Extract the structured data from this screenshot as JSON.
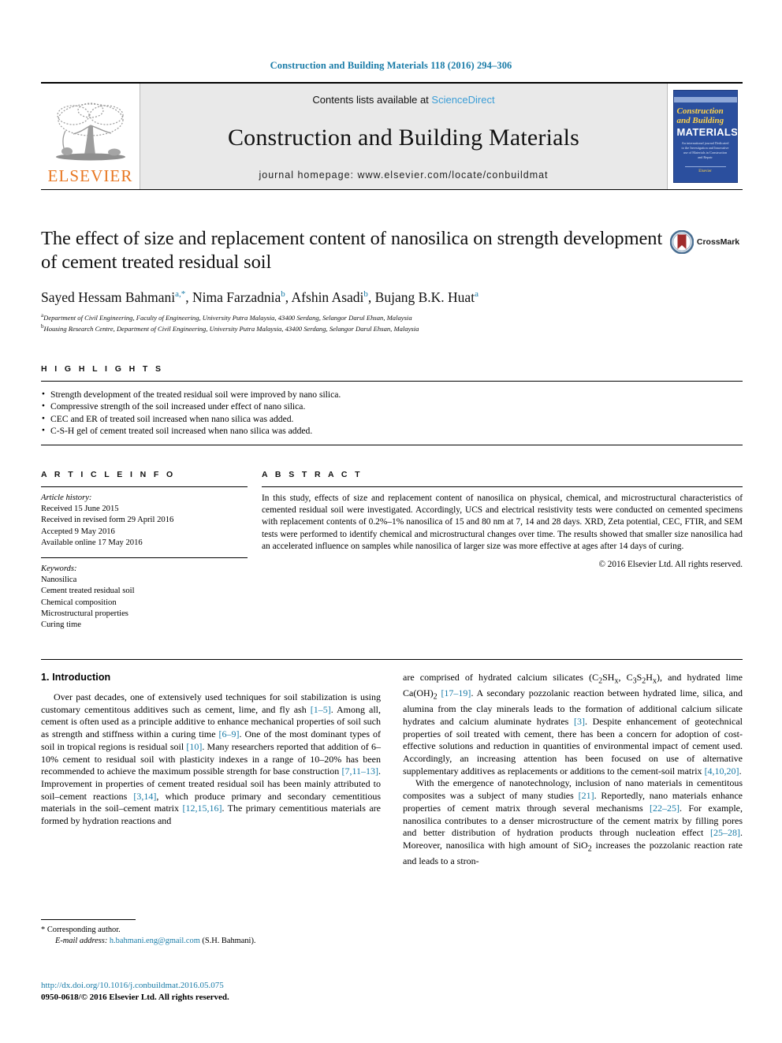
{
  "running_head": "Construction and Building Materials 118 (2016) 294–306",
  "masthead": {
    "publisher_wordmark": "ELSEVIER",
    "contents_prefix": "Contents lists available at ",
    "contents_link": "ScienceDirect",
    "journal_title": "Construction and Building Materials",
    "homepage": "journal homepage: www.elsevier.com/locate/conbuildmat",
    "cover": {
      "line1": "Construction",
      "line2": "and Building",
      "line3": "MATERIALS",
      "subtitle": "An international journal Dedicated to the Investigation and Innovative use of Materials in Construction and Repair",
      "footer": "Elsevier"
    }
  },
  "article": {
    "title": "The effect of size and replacement content of nanosilica on strength development of cement treated residual soil",
    "authors": [
      {
        "name": "Sayed Hessam Bahmani",
        "marks": "a,*"
      },
      {
        "name": "Nima Farzadnia",
        "marks": "b"
      },
      {
        "name": "Afshin Asadi",
        "marks": "b"
      },
      {
        "name": "Bujang B.K. Huat",
        "marks": "a"
      }
    ],
    "affiliations": [
      {
        "mark": "a",
        "text": "Department of Civil Engineering, Faculty of Engineering, University Putra Malaysia, 43400 Serdang, Selangor Darul Ehsan, Malaysia"
      },
      {
        "mark": "b",
        "text": "Housing Research Centre, Department of Civil Engineering, University Putra Malaysia, 43400 Serdang, Selangor Darul Ehsan, Malaysia"
      }
    ]
  },
  "crossmark": {
    "label": "CrossMark"
  },
  "highlights": {
    "heading": "H I G H L I G H T S",
    "items": [
      "Strength development of the treated residual soil were improved by nano silica.",
      "Compressive strength of the soil increased under effect of nano silica.",
      "CEC and ER of treated soil increased when nano silica was added.",
      "C-S-H gel of cement treated soil increased when nano silica was added."
    ]
  },
  "article_info": {
    "heading": "A R T I C L E   I N F O",
    "history_label": "Article history:",
    "history": [
      "Received 15 June 2015",
      "Received in revised form 29 April 2016",
      "Accepted 9 May 2016",
      "Available online 17 May 2016"
    ],
    "keywords_label": "Keywords:",
    "keywords": [
      "Nanosilica",
      "Cement treated residual soil",
      "Chemical composition",
      "Microstructural properties",
      "Curing time"
    ]
  },
  "abstract": {
    "heading": "A B S T R A C T",
    "text": "In this study, effects of size and replacement content of nanosilica on physical, chemical, and microstructural characteristics of cemented residual soil were investigated. Accordingly, UCS and electrical resistivity tests were conducted on cemented specimens with replacement contents of 0.2%–1% nanosilica of 15 and 80 nm at 7, 14 and 28 days. XRD, Zeta potential, CEC, FTIR, and SEM tests were performed to identify chemical and microstructural changes over time. The results showed that smaller size nanosilica had an accelerated influence on samples while nanosilica of larger size was more effective at ages after 14 days of curing.",
    "copyright": "© 2016 Elsevier Ltd. All rights reserved."
  },
  "body": {
    "section_number_title": "1. Introduction",
    "left_paragraph_1_a": "Over past decades, one of extensively used techniques for soil stabilization is using customary cementitous additives such as cement, lime, and fly ash ",
    "ref_1_5": "[1–5]",
    "left_paragraph_1_b": ". Among all, cement is often used as a principle additive to enhance mechanical properties of soil such as strength and stiffness within a curing time ",
    "ref_6_9": "[6–9]",
    "left_paragraph_1_c": ". One of the most dominant types of soil in tropical regions is residual soil ",
    "ref_10": "[10]",
    "left_paragraph_1_d": ". Many researchers reported that addition of 6–10% cement to residual soil with plasticity indexes in a range of 10–20% has been recommended to achieve the maximum possible strength for base construction ",
    "ref_7_11_13": "[7,11–13]",
    "left_paragraph_1_e": ". Improvement in properties of cement treated residual soil has been mainly attributed to soil–cement reactions ",
    "ref_3_14": "[3,14]",
    "left_paragraph_1_f": ", which produce primary and secondary cementitious materials in the soil–cement matrix ",
    "ref_12_15_16": "[12,15,16]",
    "left_paragraph_1_g": ". The primary cementitious materials are formed by hydration reactions and",
    "right_paragraph_1_a": "are comprised of hydrated calcium silicates (C",
    "formula_c2sh": "C2SHx",
    "formula_c3s2h": "C3S2Hx",
    "formula_caoh2": "Ca(OH)2",
    "right_paragraph_1_b": "), and hydrated lime Ca(OH)",
    "ref_17_19": "[17–19]",
    "right_paragraph_1_c": ". A secondary pozzolanic reaction between hydrated lime, silica, and alumina from the clay minerals leads to the formation of additional calcium silicate hydrates and calcium aluminate hydrates ",
    "ref_3": "[3]",
    "right_paragraph_1_d": ". Despite enhancement of geotechnical properties of soil treated with cement, there has been a concern for adoption of cost-effective solutions and reduction in quantities of environmental impact of cement used. Accordingly, an increasing attention has been focused on use of alternative supplementary additives as replacements or additions to the cement-soil matrix ",
    "ref_4_10_20": "[4,10,20]",
    "right_paragraph_1_e": ".",
    "right_paragraph_2_a": "With the emergence of nanotechnology, inclusion of nano materials in cementitous composites was a subject of many studies ",
    "ref_21": "[21]",
    "right_paragraph_2_b": ". Reportedly, nano materials enhance properties of cement matrix through several mechanisms ",
    "ref_22_25": "[22–25]",
    "right_paragraph_2_c": ". For example, nanosilica contributes to a denser microstructure of the cement matrix by filling pores and better distribution of hydration products through nucleation effect ",
    "ref_25_28": "[25–28]",
    "right_paragraph_2_d": ". Moreover, nanosilica with high amount of SiO",
    "right_paragraph_2_e": " increases the pozzolanic reaction rate and leads to a stron-"
  },
  "footnote": {
    "corresponding_mark": "*",
    "corresponding_text": "Corresponding author.",
    "email_label": "E-mail address:",
    "email": "h.bahmani.eng@gmail.com",
    "email_owner": "(S.H. Bahmani)."
  },
  "colophon": {
    "doi": "http://dx.doi.org/10.1016/j.conbuildmat.2016.05.075",
    "issn_line": "0950-0618/© 2016 Elsevier Ltd. All rights reserved."
  },
  "colors": {
    "link_blue": "#1a7ca8",
    "science_direct_blue": "#3b9dd6",
    "elsevier_orange": "#E87722",
    "cover_blue": "#2b4f9e",
    "crossmark_red": "#A02C2C"
  }
}
